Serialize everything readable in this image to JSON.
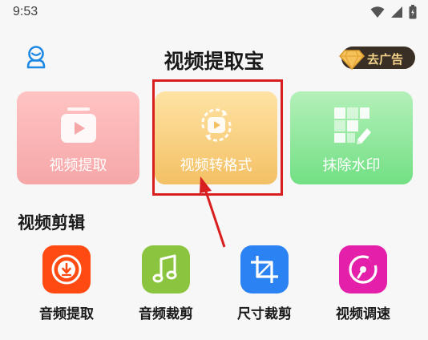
{
  "status_bar": {
    "time": "9:53"
  },
  "header": {
    "title": "视频提取宝",
    "ad_button_label": "去广告"
  },
  "feature_cards": [
    {
      "label": "视频提取",
      "icon": "video-play-icon"
    },
    {
      "label": "视频转格式",
      "icon": "video-convert-icon"
    },
    {
      "label": "抹除水印",
      "icon": "watermark-erase-icon"
    }
  ],
  "editing": {
    "section_title": "视频剪辑",
    "tools": [
      {
        "label": "音频提取",
        "icon": "audio-download-icon",
        "color": "#ff4a12"
      },
      {
        "label": "音频裁剪",
        "icon": "music-note-icon",
        "color": "#8bc540"
      },
      {
        "label": "尺寸裁剪",
        "icon": "crop-icon",
        "color": "#2b82f2"
      },
      {
        "label": "视频调速",
        "icon": "speed-dial-icon",
        "color": "#e41fa9"
      }
    ]
  },
  "colors": {
    "annotation": "#d81e1e",
    "header_badge": "#3a2f25"
  }
}
